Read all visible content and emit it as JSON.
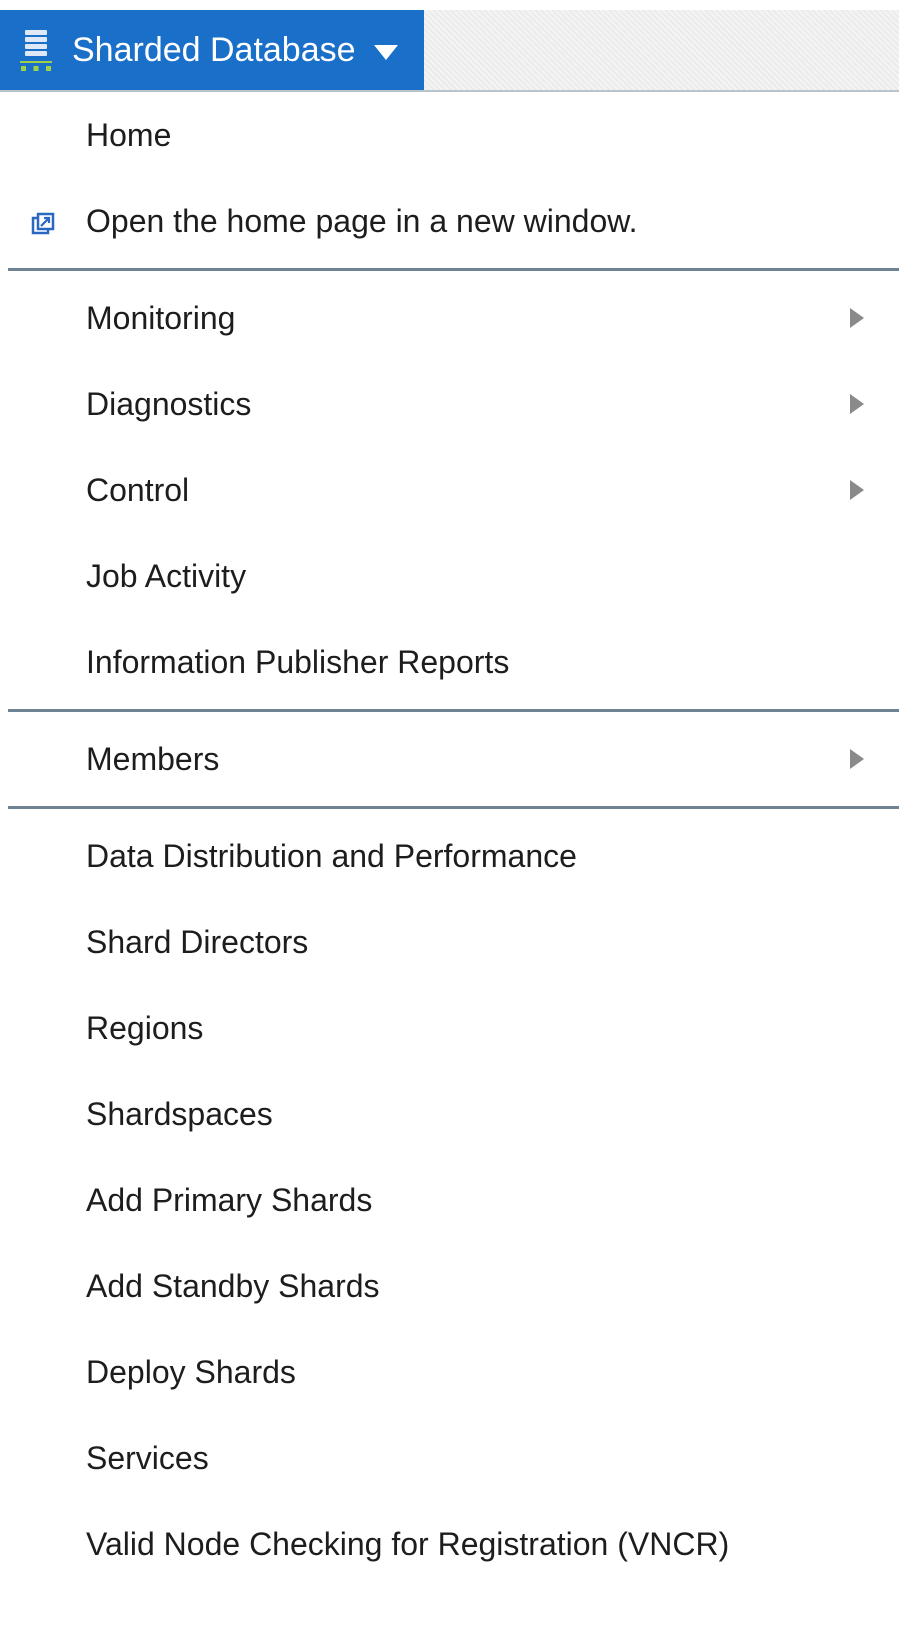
{
  "target_button": {
    "label": "Sharded Database",
    "icon": "sharded-database-icon",
    "color": "#1a6fc9"
  },
  "menu": {
    "group1": [
      {
        "label": "Home"
      },
      {
        "label": "Open the home page in a new window.",
        "icon": "new-window-icon"
      }
    ],
    "group2": [
      {
        "label": "Monitoring",
        "submenu": true
      },
      {
        "label": "Diagnostics",
        "submenu": true
      },
      {
        "label": "Control",
        "submenu": true
      },
      {
        "label": "Job Activity"
      },
      {
        "label": "Information Publisher Reports"
      }
    ],
    "group3": [
      {
        "label": "Members",
        "submenu": true
      }
    ],
    "group4": [
      {
        "label": "Data Distribution and Performance"
      },
      {
        "label": "Shard Directors"
      },
      {
        "label": "Regions"
      },
      {
        "label": "Shardspaces"
      },
      {
        "label": "Add Primary Shards"
      },
      {
        "label": "Add Standby Shards"
      },
      {
        "label": "Deploy Shards"
      },
      {
        "label": "Services"
      },
      {
        "label": "Valid Node Checking for Registration (VNCR)"
      }
    ]
  }
}
